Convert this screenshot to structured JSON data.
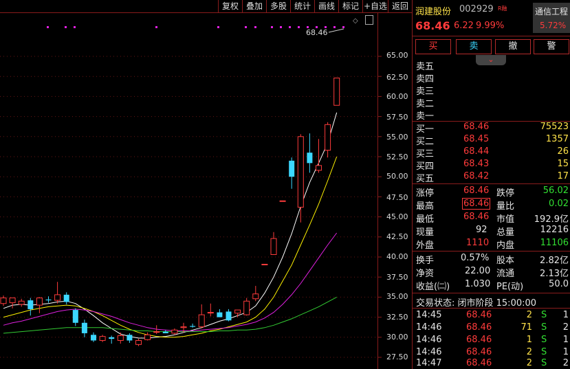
{
  "toolbar": {
    "buttons": [
      "复权",
      "叠加",
      "多股",
      "统计",
      "画线",
      "标记",
      "+自选",
      "返回"
    ]
  },
  "chart": {
    "price_label": "68.46",
    "y_ticks": [
      "65.00",
      "62.50",
      "60.00",
      "57.50",
      "55.00",
      "52.50",
      "50.00",
      "47.50",
      "45.00",
      "42.50",
      "40.00",
      "37.50",
      "35.00",
      "32.50",
      "30.00",
      "27.50"
    ]
  },
  "chart_data": {
    "type": "candlestick",
    "ylim": [
      27.5,
      67.5
    ],
    "candles": [
      {
        "o": 34.2,
        "h": 35.2,
        "l": 33.9,
        "c": 34.9
      },
      {
        "o": 34.3,
        "h": 34.7,
        "l": 33.6,
        "c": 34.9
      },
      {
        "o": 34.1,
        "h": 34.8,
        "l": 33.8,
        "c": 34.5
      },
      {
        "o": 34.6,
        "h": 34.9,
        "l": 32.7,
        "c": 33.5
      },
      {
        "o": 34.0,
        "h": 35.0,
        "l": 33.0,
        "c": 34.9
      },
      {
        "o": 34.7,
        "h": 35.1,
        "l": 34.3,
        "c": 34.6
      },
      {
        "o": 34.6,
        "h": 36.9,
        "l": 34.2,
        "c": 35.3
      },
      {
        "o": 35.3,
        "h": 35.6,
        "l": 34.1,
        "c": 34.4
      },
      {
        "o": 33.4,
        "h": 33.6,
        "l": 31.4,
        "c": 31.8
      },
      {
        "o": 31.8,
        "h": 32.2,
        "l": 30.0,
        "c": 30.5
      },
      {
        "o": 30.3,
        "h": 30.6,
        "l": 29.4,
        "c": 29.6
      },
      {
        "o": 29.6,
        "h": 30.3,
        "l": 29.4,
        "c": 30.1
      },
      {
        "o": 30.0,
        "h": 30.2,
        "l": 29.2,
        "c": 29.8
      },
      {
        "o": 29.6,
        "h": 30.6,
        "l": 29.2,
        "c": 30.2
      },
      {
        "o": 30.3,
        "h": 30.5,
        "l": 29.3,
        "c": 29.6
      },
      {
        "o": 29.1,
        "h": 29.8,
        "l": 28.9,
        "c": 29.6
      },
      {
        "o": 29.7,
        "h": 30.6,
        "l": 29.6,
        "c": 30.3
      },
      {
        "o": 30.7,
        "h": 31.5,
        "l": 30.4,
        "c": 30.7
      },
      {
        "o": 30.7,
        "h": 30.9,
        "l": 30.5,
        "c": 30.5
      },
      {
        "o": 30.5,
        "h": 31.1,
        "l": 30.3,
        "c": 30.9
      },
      {
        "o": 31.2,
        "h": 31.8,
        "l": 30.6,
        "c": 31.3
      },
      {
        "o": 31.4,
        "h": 31.7,
        "l": 31.2,
        "c": 31.3
      },
      {
        "o": 31.3,
        "h": 34.1,
        "l": 31.1,
        "c": 32.8
      },
      {
        "o": 33.1,
        "h": 34.2,
        "l": 32.6,
        "c": 33.1
      },
      {
        "o": 33.1,
        "h": 33.5,
        "l": 32.5,
        "c": 32.5
      },
      {
        "o": 33.2,
        "h": 33.5,
        "l": 32.0,
        "c": 32.1
      },
      {
        "o": 33.0,
        "h": 33.4,
        "l": 32.5,
        "c": 33.4
      },
      {
        "o": 32.8,
        "h": 34.9,
        "l": 32.7,
        "c": 34.5
      },
      {
        "o": 34.8,
        "h": 36.4,
        "l": 34.5,
        "c": 35.4
      },
      {
        "o": 39.1,
        "h": 39.1,
        "l": 39.1,
        "c": 39.1
      },
      {
        "o": 40.3,
        "h": 43.1,
        "l": 40.3,
        "c": 42.3
      },
      {
        "o": 47.0,
        "h": 47.0,
        "l": 47.0,
        "c": 47.0
      },
      {
        "o": 52.0,
        "h": 52.4,
        "l": 48.5,
        "c": 50.0
      },
      {
        "o": 46.2,
        "h": 55.3,
        "l": 44.3,
        "c": 55.0
      },
      {
        "o": 53.0,
        "h": 55.4,
        "l": 50.5,
        "c": 51.7
      },
      {
        "o": 50.8,
        "h": 54.7,
        "l": 50.5,
        "c": 51.4
      },
      {
        "o": 53.3,
        "h": 56.8,
        "l": 52.4,
        "c": 56.5
      },
      {
        "o": 58.9,
        "h": 62.3,
        "l": 58.9,
        "c": 62.3
      }
    ],
    "ma_lines": [
      {
        "color": "#ffffff",
        "values": [
          33.6,
          34.0,
          34.1,
          34.0,
          34.1,
          34.2,
          34.4,
          34.5,
          34.2,
          33.5,
          32.7,
          31.8,
          31.1,
          30.4,
          30.1,
          29.9,
          29.9,
          30.0,
          30.1,
          30.3,
          30.6,
          30.9,
          31.2,
          31.6,
          32.0,
          32.3,
          32.7,
          33.1,
          33.9,
          35.5,
          37.5,
          40.0,
          42.9,
          46.3,
          49.3,
          51.7,
          54.2,
          58.0
        ]
      },
      {
        "color": "#fff200",
        "values": [
          32.5,
          32.8,
          33.1,
          33.4,
          33.6,
          33.8,
          33.9,
          34.0,
          33.9,
          33.6,
          33.2,
          32.7,
          32.1,
          31.5,
          31.0,
          30.6,
          30.3,
          30.1,
          30.0,
          30.0,
          30.1,
          30.3,
          30.5,
          30.8,
          31.0,
          31.3,
          31.6,
          31.9,
          32.5,
          33.5,
          35.0,
          37.0,
          39.0,
          41.5,
          44.0,
          46.6,
          49.5,
          52.5
        ]
      },
      {
        "color": "#e020e0",
        "values": [
          31.5,
          31.8,
          32.0,
          32.3,
          32.6,
          32.9,
          33.2,
          33.4,
          33.5,
          33.4,
          33.2,
          32.9,
          32.6,
          32.2,
          31.8,
          31.5,
          31.2,
          31.0,
          30.9,
          30.8,
          30.8,
          30.8,
          30.9,
          31.0,
          31.1,
          31.2,
          31.4,
          31.6,
          31.9,
          32.4,
          33.1,
          34.1,
          35.3,
          36.7,
          38.3,
          39.9,
          41.5,
          43.0
        ]
      },
      {
        "color": "#33cc33",
        "values": [
          30.5,
          30.6,
          30.7,
          30.8,
          30.9,
          31.0,
          31.1,
          31.2,
          31.2,
          31.2,
          31.2,
          31.2,
          31.1,
          31.0,
          30.9,
          30.8,
          30.8,
          30.7,
          30.7,
          30.7,
          30.7,
          30.7,
          30.7,
          30.7,
          30.8,
          30.8,
          30.9,
          30.9,
          31.0,
          31.2,
          31.5,
          31.9,
          32.3,
          32.8,
          33.3,
          33.8,
          34.4,
          35.0
        ]
      }
    ]
  },
  "quote": {
    "name": "润建股份",
    "code": "002929",
    "tag": "R融",
    "sector": "通信工程",
    "sector_change": "5.72%",
    "price": "68.46",
    "change": "6.22",
    "change_pct": "9.99%"
  },
  "trade_buttons": [
    "买",
    "卖",
    "撤",
    "警"
  ],
  "sell_labels": [
    "卖五",
    "卖四",
    "卖三",
    "卖二",
    "卖一"
  ],
  "buy_rows": [
    {
      "label": "买一",
      "price": "68.46",
      "vol": "75523"
    },
    {
      "label": "买二",
      "price": "68.45",
      "vol": "1357"
    },
    {
      "label": "买三",
      "price": "68.44",
      "vol": "26"
    },
    {
      "label": "买四",
      "price": "68.43",
      "vol": "15"
    },
    {
      "label": "买五",
      "price": "68.42",
      "vol": "17"
    }
  ],
  "stats": {
    "limit_up_label": "涨停",
    "limit_up": "68.46",
    "limit_down_label": "跌停",
    "limit_down": "56.02",
    "high_label": "最高",
    "high": "68.46",
    "vol_ratio_label": "量比",
    "vol_ratio": "0.02",
    "low_label": "最低",
    "low": "68.46",
    "mktcap_label": "市值",
    "mktcap": "192.9亿",
    "cur_vol_label": "现量",
    "cur_vol": "92",
    "total_vol_label": "总量",
    "total_vol": "12216",
    "outer_label": "外盘",
    "outer": "1110",
    "inner_label": "内盘",
    "inner": "11106",
    "turnover_label": "换手",
    "turnover": "0.57%",
    "capital_label": "股本",
    "capital": "2.82亿",
    "nav_label": "净资",
    "nav": "22.00",
    "float_label": "流通",
    "float": "2.13亿",
    "eps_label": "收益(㈡)",
    "eps": "1.030",
    "pe_label": "PE(动)",
    "pe": "50.0"
  },
  "trade_status": "交易状态: 闭市阶段 15:00:00",
  "ticks": [
    {
      "time": "14:45",
      "price": "68.46",
      "vol": "2",
      "side": "S",
      "n": "1"
    },
    {
      "time": "14:46",
      "price": "68.46",
      "vol": "71",
      "side": "S",
      "n": "2"
    },
    {
      "time": "14:46",
      "price": "68.46",
      "vol": "1",
      "side": "S",
      "n": "1"
    },
    {
      "time": "14:46",
      "price": "68.46",
      "vol": "2",
      "side": "S",
      "n": "1"
    },
    {
      "time": "14:47",
      "price": "68.46",
      "vol": "2",
      "side": "S",
      "n": "2"
    }
  ]
}
